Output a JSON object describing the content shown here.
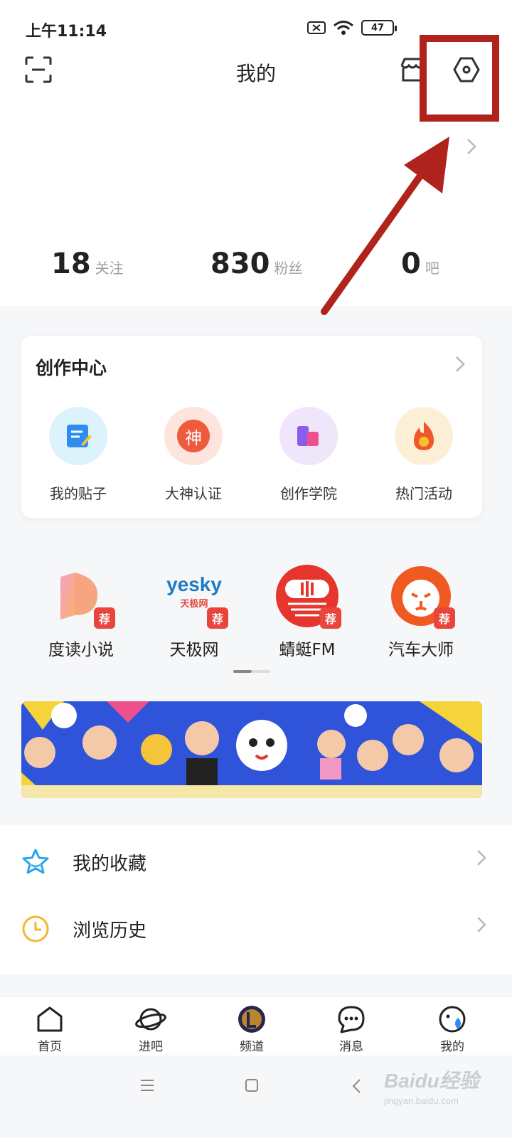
{
  "status_bar": {
    "time": "上午11:14",
    "battery": "47"
  },
  "header": {
    "title": "我的"
  },
  "profile": {
    "stats": [
      {
        "value": "18",
        "label": "关注"
      },
      {
        "value": "830",
        "label": "粉丝"
      },
      {
        "value": "0",
        "label": "吧"
      }
    ]
  },
  "creation_center": {
    "title": "创作中心",
    "items": [
      {
        "label": "我的贴子",
        "icon": "post-icon"
      },
      {
        "label": "大神认证",
        "icon": "verify-icon",
        "glyph": "神"
      },
      {
        "label": "创作学院",
        "icon": "academy-icon"
      },
      {
        "label": "热门活动",
        "icon": "fire-icon"
      }
    ]
  },
  "apps": {
    "badge": "荐",
    "items": [
      {
        "label": "度读小说"
      },
      {
        "label": "天极网",
        "logo_text": "yesky",
        "logo_sub": "天极网"
      },
      {
        "label": "蜻蜓FM"
      },
      {
        "label": "汽车大师"
      }
    ]
  },
  "list": {
    "items": [
      {
        "label": "我的收藏",
        "icon": "star-icon"
      },
      {
        "label": "浏览历史",
        "icon": "clock-icon"
      }
    ]
  },
  "bottom_nav": {
    "items": [
      {
        "label": "首页"
      },
      {
        "label": "进吧"
      },
      {
        "label": "频道"
      },
      {
        "label": "消息"
      },
      {
        "label": "我的"
      }
    ]
  },
  "watermark": {
    "brand": "Baidu经验",
    "url": "jingyan.baidu.com"
  },
  "colors": {
    "accent_red": "#e8463c",
    "annotation_red": "#b0231c",
    "banner_blue": "#2f53d9"
  }
}
